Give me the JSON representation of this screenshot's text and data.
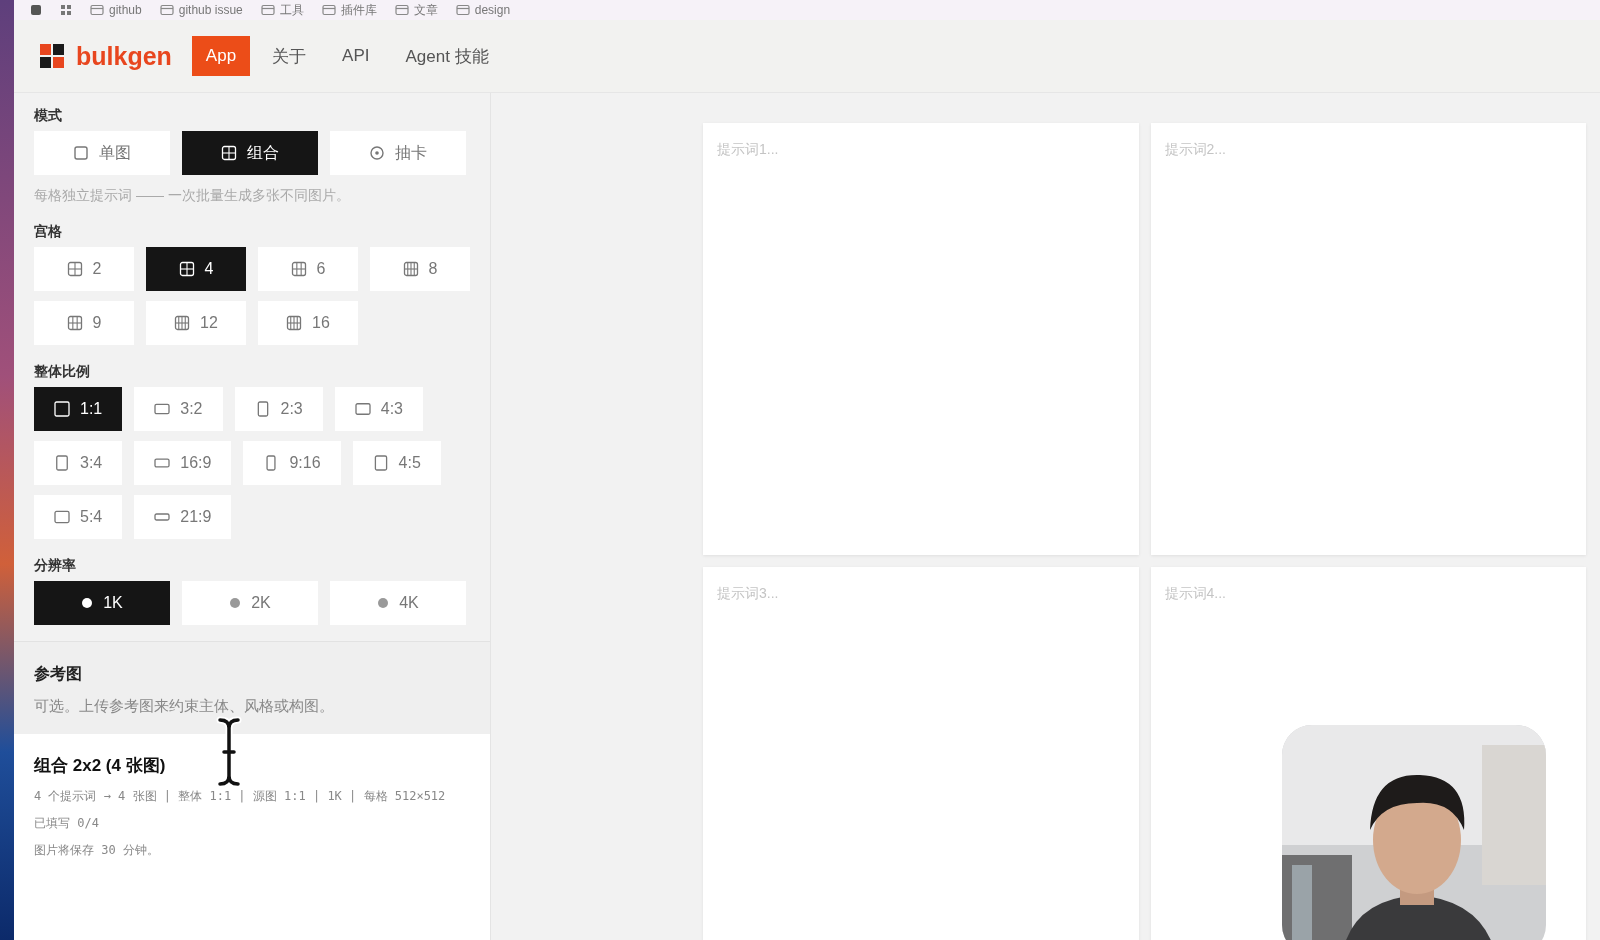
{
  "bookmarks": [
    {
      "label": "github"
    },
    {
      "label": "github issue"
    },
    {
      "label": "工具"
    },
    {
      "label": "插件库"
    },
    {
      "label": "文章"
    },
    {
      "label": "design"
    }
  ],
  "header": {
    "logo": "bulkgen",
    "tabs": [
      {
        "label": "App",
        "selected": true
      },
      {
        "label": "关于",
        "selected": false
      },
      {
        "label": "API",
        "selected": false
      },
      {
        "label": "Agent 技能",
        "selected": false
      }
    ]
  },
  "sidebar": {
    "sections": [
      {
        "title": "模式",
        "kind": "mode",
        "options": [
          {
            "label": "单图",
            "selected": false
          },
          {
            "label": "组合",
            "selected": true
          },
          {
            "label": "抽卡",
            "selected": false
          }
        ],
        "hint": "每格独立提示词 —— 一次批量生成多张不同图片。"
      },
      {
        "title": "宫格",
        "kind": "grid",
        "options": [
          {
            "label": "2",
            "selected": false
          },
          {
            "label": "4",
            "selected": true
          },
          {
            "label": "6",
            "selected": false
          },
          {
            "label": "8",
            "selected": false
          },
          {
            "label": "9",
            "selected": false
          },
          {
            "label": "12",
            "selected": false
          },
          {
            "label": "16",
            "selected": false
          }
        ]
      },
      {
        "title": "整体比例",
        "kind": "ratio",
        "options": [
          {
            "label": "1:1",
            "selected": true
          },
          {
            "label": "3:2",
            "selected": false
          },
          {
            "label": "2:3",
            "selected": false
          },
          {
            "label": "4:3",
            "selected": false
          },
          {
            "label": "3:4",
            "selected": false
          },
          {
            "label": "16:9",
            "selected": false
          },
          {
            "label": "9:16",
            "selected": false
          },
          {
            "label": "4:5",
            "selected": false
          },
          {
            "label": "5:4",
            "selected": false
          },
          {
            "label": "21:9",
            "selected": false
          }
        ]
      },
      {
        "title": "分辨率",
        "kind": "resolution",
        "options": [
          {
            "label": "1K",
            "selected": true
          },
          {
            "label": "2K",
            "selected": false
          },
          {
            "label": "4K",
            "selected": false
          }
        ]
      }
    ],
    "reference": {
      "title": "参考图",
      "hint": "可选。上传参考图来约束主体、风格或构图。"
    },
    "summary": {
      "title": "组合 2x2 (4 张图)",
      "lines": [
        "4 个提示词 → 4 张图 | 整体 1:1 | 源图 1:1 | 1K | 每格 512×512",
        "已填写 0/4",
        "图片将保存 30 分钟。"
      ]
    }
  },
  "prompts": [
    {
      "placeholder": "提示词1..."
    },
    {
      "placeholder": "提示词2..."
    },
    {
      "placeholder": "提示词3..."
    },
    {
      "placeholder": "提示词4..."
    }
  ]
}
